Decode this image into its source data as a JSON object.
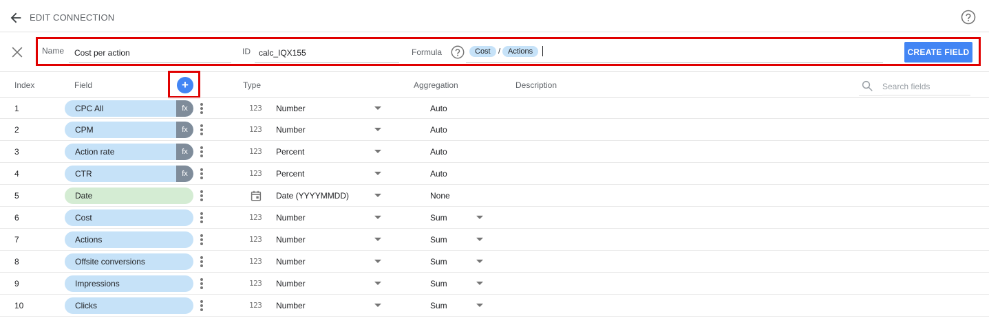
{
  "header": {
    "title": "EDIT CONNECTION"
  },
  "editor": {
    "name_label": "Name",
    "name_value": "Cost per action",
    "id_label": "ID",
    "id_value": "calc_IQX155",
    "formula_label": "Formula",
    "formula_tokens": [
      "Cost",
      "Actions"
    ],
    "formula_operator": "/",
    "create_button": "CREATE FIELD"
  },
  "table": {
    "columns": {
      "index": "Index",
      "field": "Field",
      "type": "Type",
      "aggregation": "Aggregation",
      "description": "Description"
    },
    "search_placeholder": "Search fields",
    "add_symbol": "+",
    "fx_label": "fx",
    "number_icon_text": "123",
    "rows": [
      {
        "index": "1",
        "field": "CPC All",
        "type": "Number",
        "aggregation": "Auto",
        "calculated": true,
        "kind": "metric",
        "agg_dropdown": false
      },
      {
        "index": "2",
        "field": "CPM",
        "type": "Number",
        "aggregation": "Auto",
        "calculated": true,
        "kind": "metric",
        "agg_dropdown": false
      },
      {
        "index": "3",
        "field": "Action rate",
        "type": "Percent",
        "aggregation": "Auto",
        "calculated": true,
        "kind": "metric",
        "agg_dropdown": false
      },
      {
        "index": "4",
        "field": "CTR",
        "type": "Percent",
        "aggregation": "Auto",
        "calculated": true,
        "kind": "metric",
        "agg_dropdown": false
      },
      {
        "index": "5",
        "field": "Date",
        "type": "Date (YYYYMMDD)",
        "aggregation": "None",
        "calculated": false,
        "kind": "dimension",
        "agg_dropdown": false
      },
      {
        "index": "6",
        "field": "Cost",
        "type": "Number",
        "aggregation": "Sum",
        "calculated": false,
        "kind": "metric",
        "agg_dropdown": true
      },
      {
        "index": "7",
        "field": "Actions",
        "type": "Number",
        "aggregation": "Sum",
        "calculated": false,
        "kind": "metric",
        "agg_dropdown": true
      },
      {
        "index": "8",
        "field": "Offsite conversions",
        "type": "Number",
        "aggregation": "Sum",
        "calculated": false,
        "kind": "metric",
        "agg_dropdown": true
      },
      {
        "index": "9",
        "field": "Impressions",
        "type": "Number",
        "aggregation": "Sum",
        "calculated": false,
        "kind": "metric",
        "agg_dropdown": true
      },
      {
        "index": "10",
        "field": "Clicks",
        "type": "Number",
        "aggregation": "Sum",
        "calculated": false,
        "kind": "metric",
        "agg_dropdown": true
      }
    ]
  },
  "colors": {
    "accent": "#4285f4",
    "highlight_box": "#e00000",
    "metric_chip": "#c6e2f8",
    "dimension_chip": "#d4ecd3",
    "fx_badge": "#7f8c9a"
  }
}
